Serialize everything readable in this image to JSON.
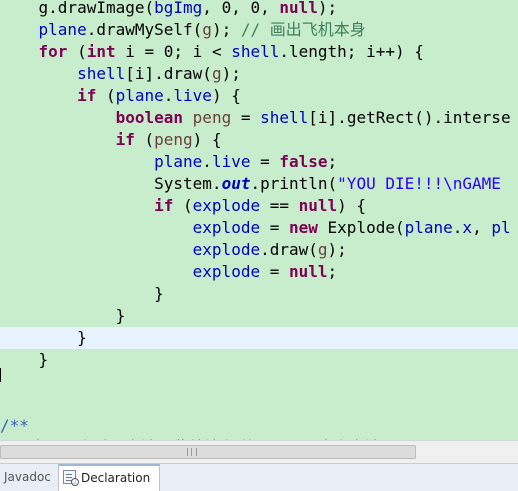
{
  "editor": {
    "lines": [
      [
        {
          "t": "    g.drawImage(",
          "c": "pl"
        },
        {
          "t": "bgImg",
          "c": "fld"
        },
        {
          "t": ", 0, 0, ",
          "c": "pl"
        },
        {
          "t": "null",
          "c": "kw"
        },
        {
          "t": ");",
          "c": "pl"
        }
      ],
      [
        {
          "t": "    ",
          "c": "pl"
        },
        {
          "t": "plane",
          "c": "fld"
        },
        {
          "t": ".drawMySelf(",
          "c": "pl"
        },
        {
          "t": "g",
          "c": "var"
        },
        {
          "t": "); ",
          "c": "pl"
        },
        {
          "t": "// 画出飞机本身",
          "c": "cm"
        }
      ],
      [
        {
          "t": "    ",
          "c": "pl"
        },
        {
          "t": "for",
          "c": "kw"
        },
        {
          "t": " (",
          "c": "pl"
        },
        {
          "t": "int",
          "c": "kw"
        },
        {
          "t": " i = 0; i < ",
          "c": "pl"
        },
        {
          "t": "shell",
          "c": "fld"
        },
        {
          "t": ".length; i++) {",
          "c": "pl"
        }
      ],
      [
        {
          "t": "        ",
          "c": "pl"
        },
        {
          "t": "shell",
          "c": "fld"
        },
        {
          "t": "[i].draw(",
          "c": "pl"
        },
        {
          "t": "g",
          "c": "var"
        },
        {
          "t": ");",
          "c": "pl"
        }
      ],
      [
        {
          "t": "        ",
          "c": "pl"
        },
        {
          "t": "if",
          "c": "kw"
        },
        {
          "t": " (",
          "c": "pl"
        },
        {
          "t": "plane",
          "c": "fld"
        },
        {
          "t": ".",
          "c": "pl"
        },
        {
          "t": "live",
          "c": "fld"
        },
        {
          "t": ") {",
          "c": "pl"
        }
      ],
      [
        {
          "t": "            ",
          "c": "pl"
        },
        {
          "t": "boolean",
          "c": "kw"
        },
        {
          "t": " ",
          "c": "pl"
        },
        {
          "t": "peng",
          "c": "var"
        },
        {
          "t": " = ",
          "c": "pl"
        },
        {
          "t": "shell",
          "c": "fld"
        },
        {
          "t": "[i].getRect().interse",
          "c": "pl"
        }
      ],
      [
        {
          "t": "            ",
          "c": "pl"
        },
        {
          "t": "if",
          "c": "kw"
        },
        {
          "t": " (",
          "c": "pl"
        },
        {
          "t": "peng",
          "c": "var"
        },
        {
          "t": ") {",
          "c": "pl"
        }
      ],
      [
        {
          "t": "                ",
          "c": "pl"
        },
        {
          "t": "plane",
          "c": "fld"
        },
        {
          "t": ".",
          "c": "pl"
        },
        {
          "t": "live",
          "c": "fld"
        },
        {
          "t": " = ",
          "c": "pl"
        },
        {
          "t": "false",
          "c": "kw"
        },
        {
          "t": ";",
          "c": "pl"
        }
      ],
      [
        {
          "t": "                System.",
          "c": "pl"
        },
        {
          "t": "out",
          "c": "sf"
        },
        {
          "t": ".println(",
          "c": "pl"
        },
        {
          "t": "\"YOU DIE!!!\\nGAME",
          "c": "str"
        }
      ],
      [
        {
          "t": "                ",
          "c": "pl"
        },
        {
          "t": "if",
          "c": "kw"
        },
        {
          "t": " (",
          "c": "pl"
        },
        {
          "t": "explode",
          "c": "fld"
        },
        {
          "t": " == ",
          "c": "pl"
        },
        {
          "t": "null",
          "c": "kw"
        },
        {
          "t": ") {",
          "c": "pl"
        }
      ],
      [
        {
          "t": "                    ",
          "c": "pl"
        },
        {
          "t": "explode",
          "c": "fld"
        },
        {
          "t": " = ",
          "c": "pl"
        },
        {
          "t": "new",
          "c": "kw"
        },
        {
          "t": " Explode(",
          "c": "pl"
        },
        {
          "t": "plane",
          "c": "fld"
        },
        {
          "t": ".",
          "c": "pl"
        },
        {
          "t": "x",
          "c": "fld"
        },
        {
          "t": ", ",
          "c": "pl"
        },
        {
          "t": "pl",
          "c": "fld"
        }
      ],
      [
        {
          "t": "                    ",
          "c": "pl"
        },
        {
          "t": "explode",
          "c": "fld"
        },
        {
          "t": ".draw(",
          "c": "pl"
        },
        {
          "t": "g",
          "c": "var"
        },
        {
          "t": ");",
          "c": "pl"
        }
      ],
      [
        {
          "t": "                    ",
          "c": "pl"
        },
        {
          "t": "explode",
          "c": "fld"
        },
        {
          "t": " = ",
          "c": "pl"
        },
        {
          "t": "null",
          "c": "kw"
        },
        {
          "t": ";",
          "c": "pl"
        }
      ],
      [
        {
          "t": "                }",
          "c": "pl"
        }
      ],
      [
        {
          "t": "            }",
          "c": "pl"
        }
      ],
      [
        {
          "t": "        }",
          "c": "pl"
        }
      ],
      [
        {
          "t": "    }",
          "c": "pl"
        }
      ],
      [
        {
          "t": "",
          "c": "pl"
        }
      ],
      [
        {
          "t": "",
          "c": "pl"
        }
      ],
      [
        {
          "t": "/**",
          "c": "cmd"
        }
      ],
      [
        {
          "t": " * 这是一个重要方法，此处注释说明一下。这个方法",
          "c": "cmd"
        }
      ]
    ]
  },
  "tabs": {
    "javadoc": "Javadoc",
    "declaration": "Declaration"
  }
}
